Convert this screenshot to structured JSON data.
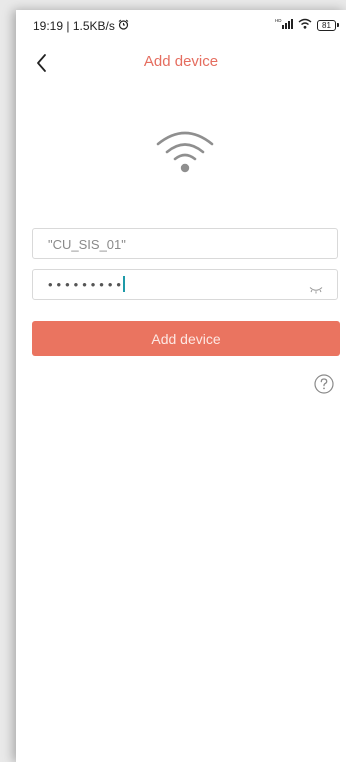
{
  "status_bar": {
    "time_speed": "19:19 | 1.5KB/s",
    "alarm_icon": "alarm-clock-icon",
    "network_label": "HD",
    "battery_level": "81"
  },
  "header": {
    "back_icon": "chevron-left-icon",
    "title": "Add device"
  },
  "wifi_icon": "wifi-icon",
  "form": {
    "ssid_value": "\"CU_SIS_01\"",
    "password_masked": "•••••••••",
    "eye_icon": "eye-closed-icon"
  },
  "add_button_label": "Add device",
  "help_icon": "question-circle-icon",
  "colors": {
    "accent": "#ea7460",
    "title": "#e56d5f",
    "caret": "#1e9aa8"
  }
}
